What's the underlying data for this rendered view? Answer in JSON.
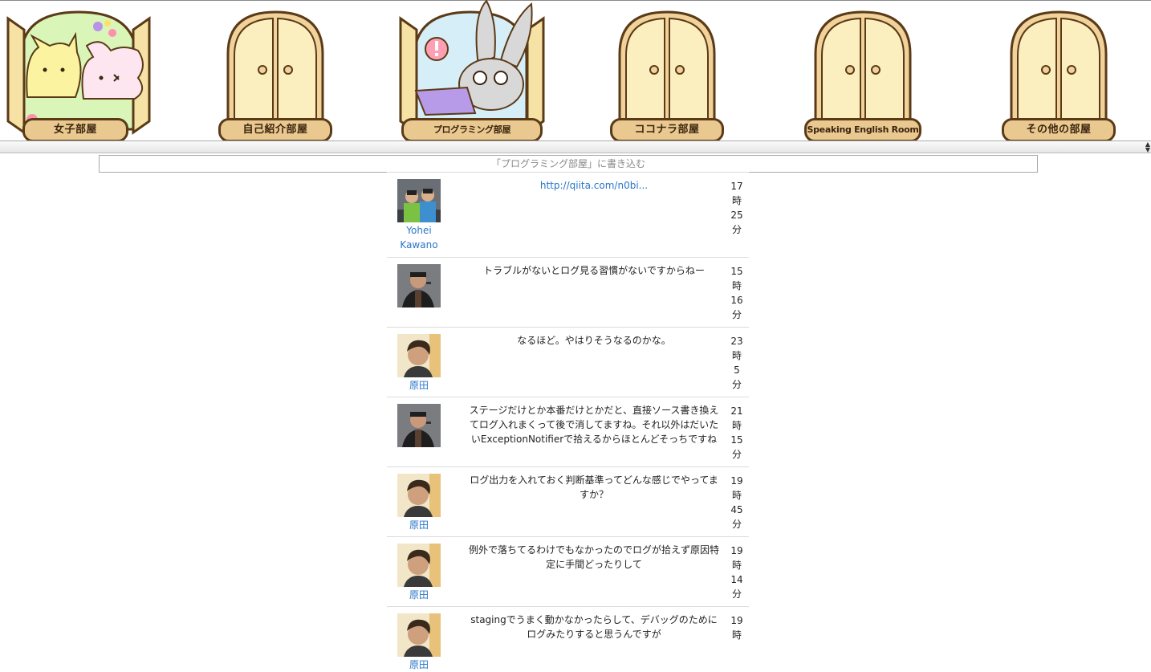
{
  "rooms": [
    {
      "label": "女子部屋",
      "kind": "open-cats"
    },
    {
      "label": "自己紹介部屋",
      "kind": "closed"
    },
    {
      "label": "プログラミング部屋",
      "kind": "open-rabbit"
    },
    {
      "label": "ココナラ部屋",
      "kind": "closed"
    },
    {
      "label": "Speaking English Room",
      "kind": "closed"
    },
    {
      "label": "その他の部屋",
      "kind": "closed"
    }
  ],
  "post_input": {
    "placeholder": "「プログラミング部屋」に書き込む"
  },
  "posts": [
    {
      "user": "Yohei Kawano",
      "avatar": "group-photo-avatar",
      "message": "http://qiita.com/n0bi...",
      "is_link": true,
      "time": [
        "17",
        "時",
        "25",
        "分"
      ]
    },
    {
      "user": "",
      "avatar": "speaker-photo-avatar",
      "message": "トラブルがないとログ見る習慣がないですからねー",
      "is_link": false,
      "time": [
        "15",
        "時",
        "16",
        "分"
      ]
    },
    {
      "user": "原田",
      "avatar": "profile-photo-avatar",
      "message": "なるほど。やはりそうなるのかな。",
      "is_link": false,
      "time": [
        "23",
        "時",
        "5",
        "分"
      ]
    },
    {
      "user": "",
      "avatar": "speaker-photo-avatar",
      "message": "ステージだけとか本番だけとかだと、直接ソース書き換えてログ入れまくって後で消してますね。それ以外はだいたいExceptionNotifierで拾えるからほとんどそっちですね",
      "is_link": false,
      "time": [
        "21",
        "時",
        "15",
        "分"
      ]
    },
    {
      "user": "原田",
      "avatar": "profile-photo-avatar",
      "message": "ログ出力を入れておく判断基準ってどんな感じでやってますか？",
      "is_link": false,
      "time": [
        "19",
        "時",
        "45",
        "分"
      ]
    },
    {
      "user": "原田",
      "avatar": "profile-photo-avatar",
      "message": "例外で落ちてるわけでもなかったのでログが拾えず原因特定に手間どったりして",
      "is_link": false,
      "time": [
        "19",
        "時",
        "14",
        "分"
      ]
    },
    {
      "user": "原田",
      "avatar": "profile-photo-avatar",
      "message": "stagingでうまく動かなかったらして、デバッグのためにログみたりすると思うんですが",
      "is_link": false,
      "time": [
        "19",
        "時",
        "",
        ""
      ]
    }
  ]
}
